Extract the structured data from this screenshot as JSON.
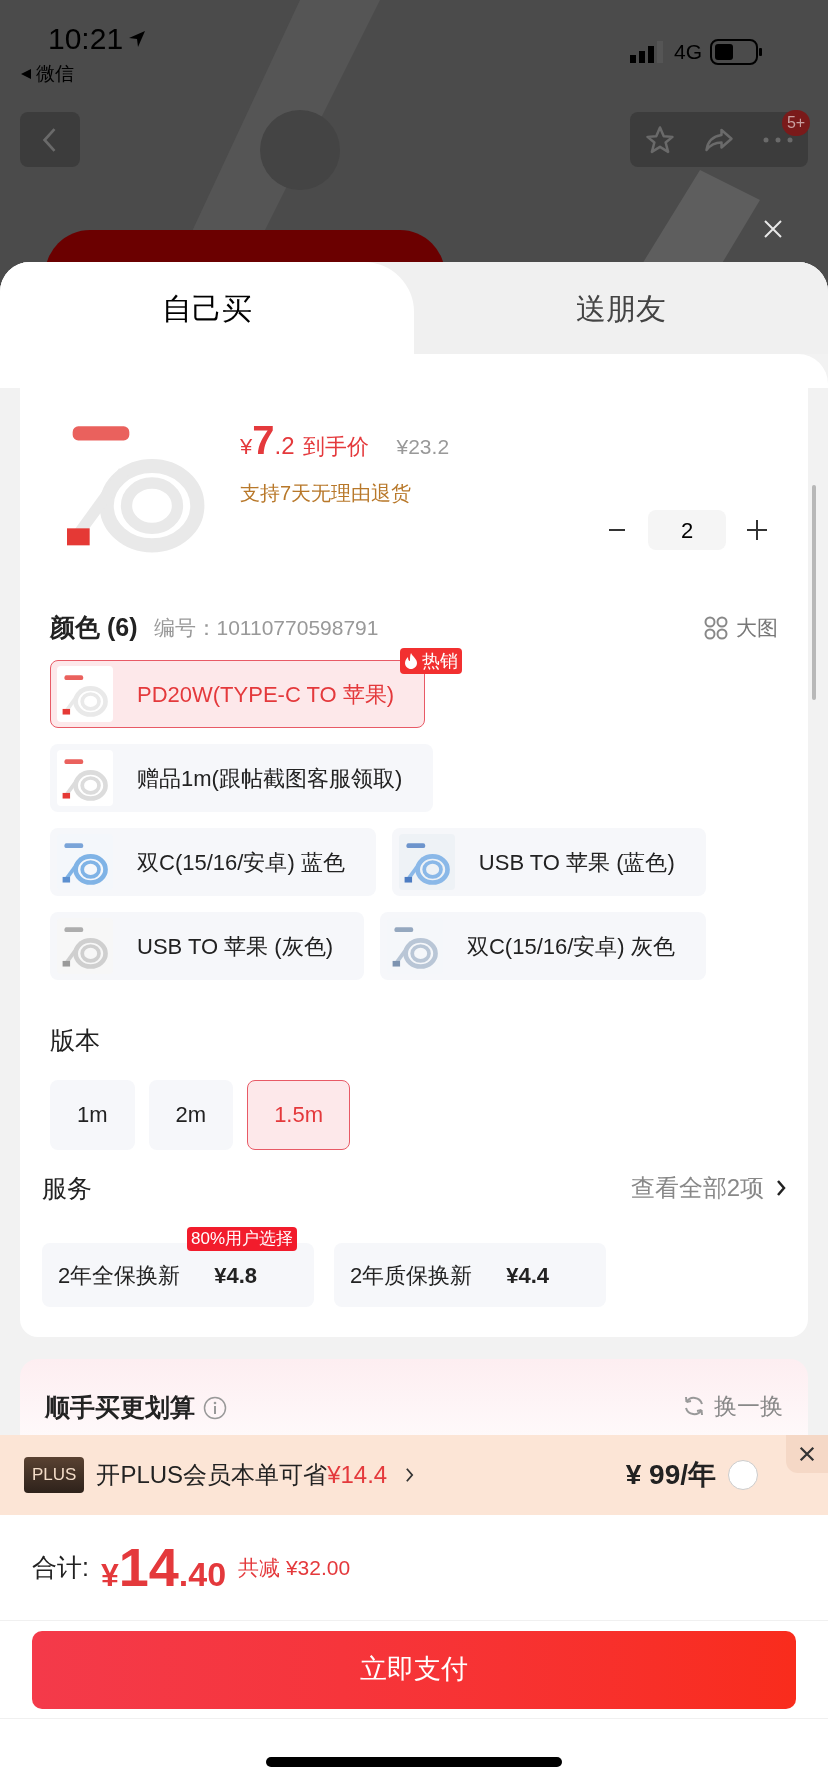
{
  "status_bar": {
    "time": "10:21",
    "back_app": "微信",
    "network": "4G"
  },
  "nav": {
    "badge": "5+"
  },
  "tabs": [
    {
      "label": "自己买",
      "selected": true
    },
    {
      "label": "送朋友",
      "selected": false
    }
  ],
  "product": {
    "currency": "¥",
    "price_int": "7",
    "price_dec": ".2",
    "price_label": "到手价",
    "original_price": "¥23.2",
    "return_policy": "支持7天无理由退货",
    "quantity": "2"
  },
  "color_section": {
    "title": "颜色 (6)",
    "code": "编号：10110770598791",
    "big_image": "大图",
    "options": [
      {
        "label": "PD20W(TYPE-C TO 苹果)",
        "selected": true,
        "badge": "热销"
      },
      {
        "label": "赠品1m(跟帖截图客服领取)",
        "selected": false
      },
      {
        "label": "双C(15/16/安卓) 蓝色",
        "selected": false
      },
      {
        "label": "USB TO 苹果 (蓝色)",
        "selected": false
      },
      {
        "label": "USB TO 苹果 (灰色)",
        "selected": false
      },
      {
        "label": "双C(15/16/安卓) 灰色",
        "selected": false
      }
    ]
  },
  "version_section": {
    "title": "版本",
    "options": [
      {
        "label": "1m",
        "selected": false
      },
      {
        "label": "2m",
        "selected": false
      },
      {
        "label": "1.5m",
        "selected": true
      }
    ]
  },
  "service_section": {
    "title": "服务",
    "view_all": "查看全部2项",
    "options": [
      {
        "name": "2年全保换新",
        "price": "¥4.8",
        "badge": "80%用户选择"
      },
      {
        "name": "2年质保换新",
        "price": "¥4.4"
      }
    ]
  },
  "addon": {
    "title": "顺手买更划算",
    "refresh": "换一换"
  },
  "plus_bar": {
    "logo": "PLUS",
    "text": "开PLUS会员本单可省",
    "saving": "¥14.4",
    "price": "¥ 99/年",
    "checked": false
  },
  "footer": {
    "label": "合计:",
    "currency": "¥",
    "total_int": "14",
    "total_dec": ".40",
    "discount": "共减 ¥32.00",
    "pay_button": "立即支付"
  }
}
